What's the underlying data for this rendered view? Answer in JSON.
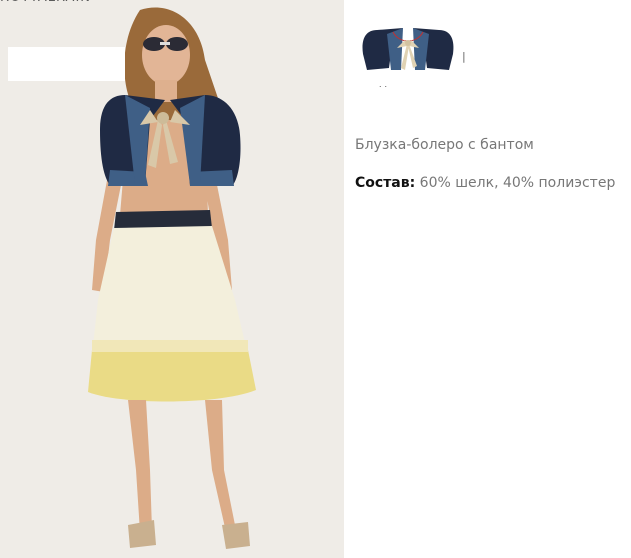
{
  "header": {
    "partial_text": "ROTTALRAIN"
  },
  "product": {
    "name": "Блузка-болеро с бантом",
    "composition_label": "Состав:",
    "composition_value": " 60% шелк, 40% полиэстер"
  },
  "thumbnails": {
    "separator": "|",
    "marker": "˙˙"
  },
  "colors": {
    "photo_bg": "#efece7",
    "bolero_navy": "#1f2a44",
    "bolero_denim": "#3f5f86",
    "bow_beige": "#d9c8a8",
    "skirt_cream": "#f3efdc",
    "skirt_yellow": "#eadb86",
    "text_gray": "#777777"
  }
}
